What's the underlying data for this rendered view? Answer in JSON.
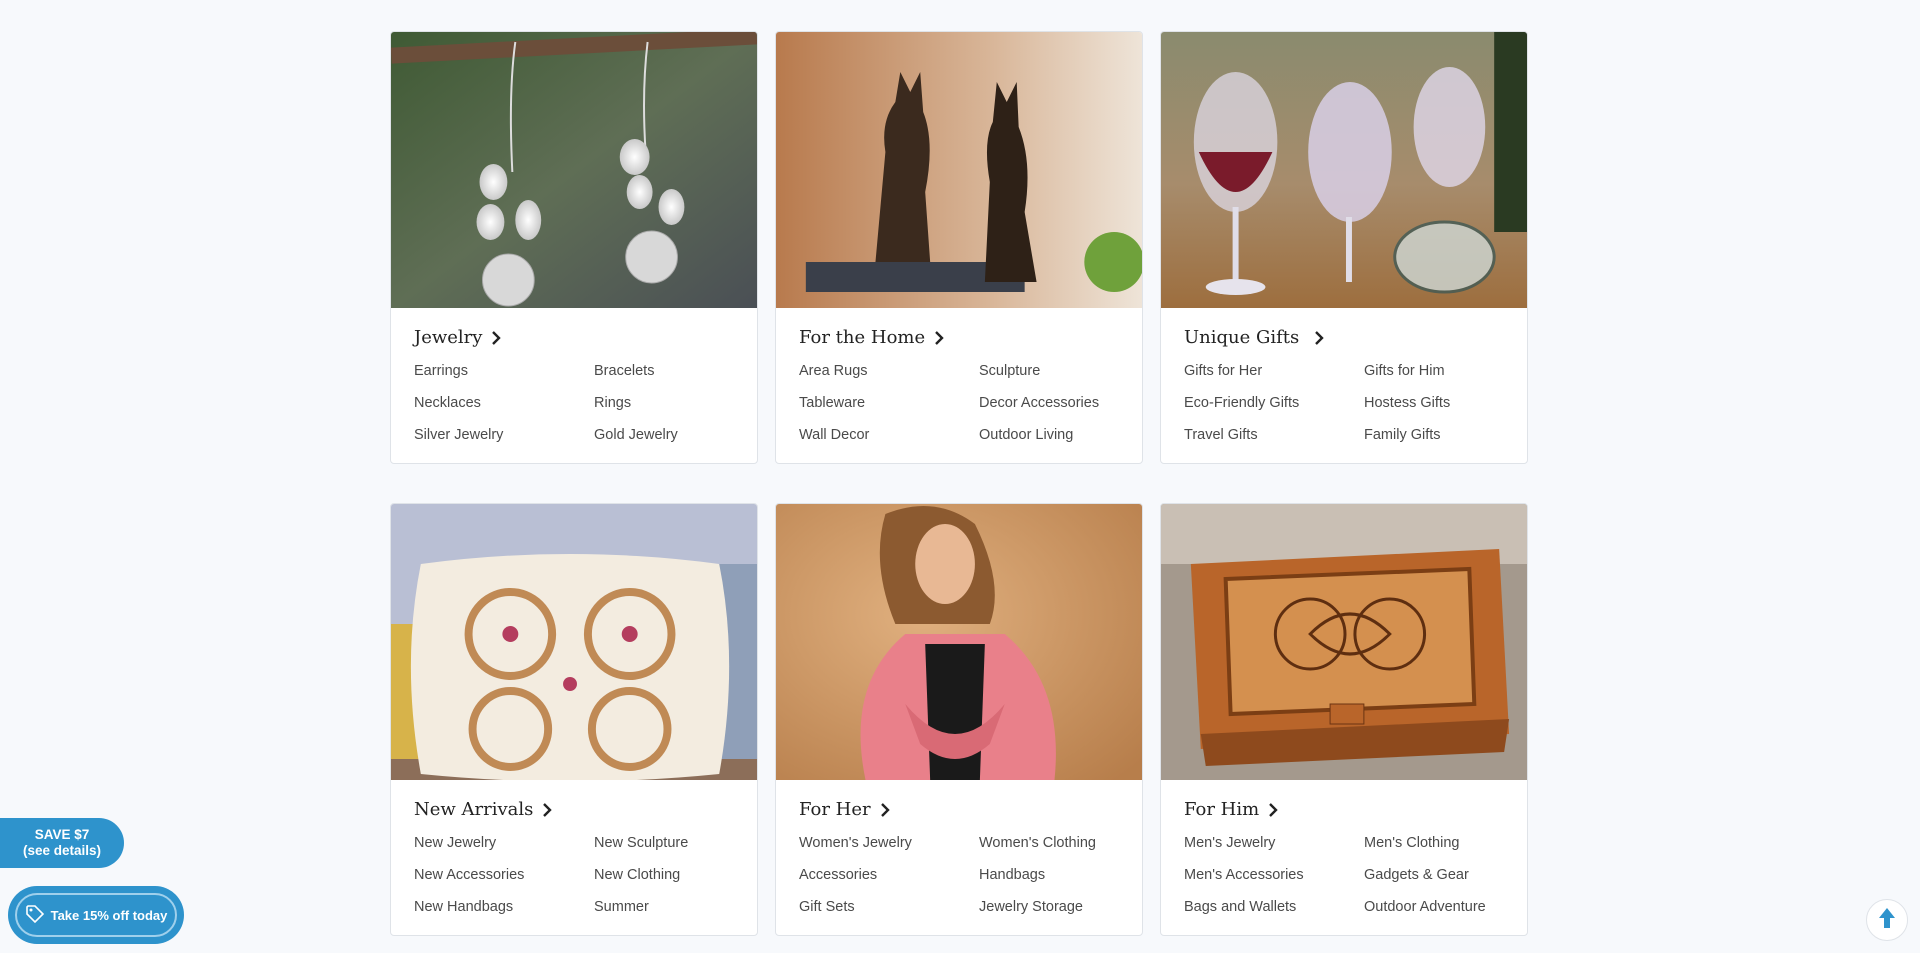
{
  "categories": [
    {
      "title": "Jewelry",
      "links": [
        "Earrings",
        "Bracelets",
        "Necklaces",
        "Rings",
        "Silver Jewelry",
        "Gold Jewelry"
      ]
    },
    {
      "title": "For the Home",
      "links": [
        "Area Rugs",
        "Sculpture",
        "Tableware",
        "Decor Accessories",
        "Wall Decor",
        "Outdoor Living"
      ]
    },
    {
      "title": "Unique Gifts",
      "links": [
        "Gifts for Her",
        "Gifts for Him",
        "Eco-Friendly Gifts",
        "Hostess Gifts",
        "Travel Gifts",
        "Family Gifts"
      ]
    },
    {
      "title": "New Arrivals",
      "links": [
        "New Jewelry",
        "New Sculpture",
        "New Accessories",
        "New Clothing",
        "New Handbags",
        "Summer"
      ]
    },
    {
      "title": "For Her",
      "links": [
        "Women's Jewelry",
        "Women's Clothing",
        "Accessories",
        "Handbags",
        "Gift Sets",
        "Jewelry Storage"
      ]
    },
    {
      "title": "For Him",
      "links": [
        "Men's Jewelry",
        "Men's Clothing",
        "Men's Accessories",
        "Gadgets & Gear",
        "Bags and Wallets",
        "Outdoor Adventure"
      ]
    }
  ],
  "save_tab": {
    "line1": "SAVE $7",
    "line2": "(see details)"
  },
  "promo": {
    "label": "Take 15% off today",
    "icon": "tag-icon"
  },
  "scroll_top": {
    "icon": "arrow-up-icon"
  },
  "colors": {
    "accent": "#2e93cc",
    "background": "#f7f9fc",
    "card_border": "#dfe3e8"
  }
}
